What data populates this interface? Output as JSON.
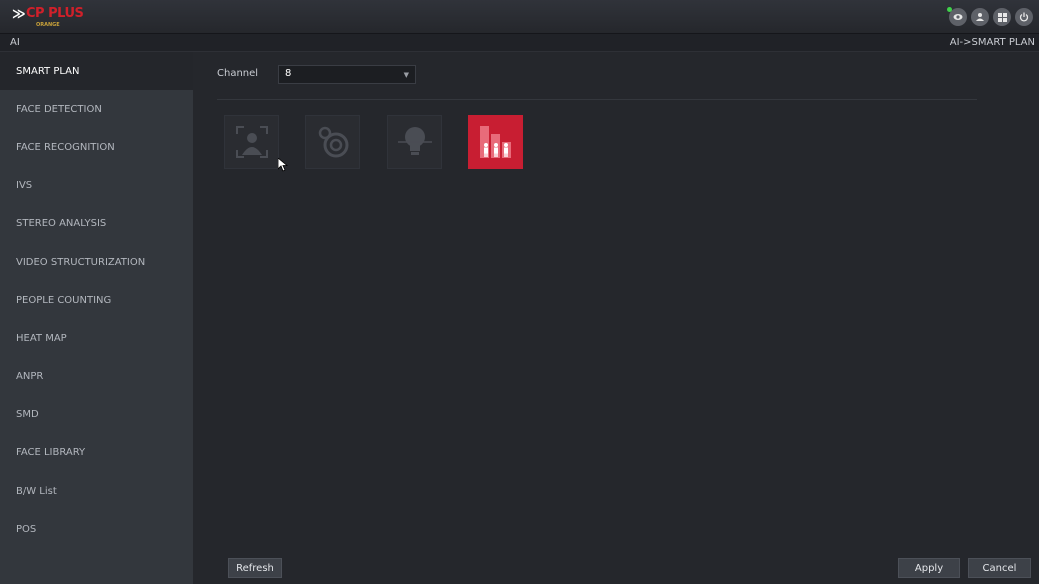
{
  "header": {
    "logo_brand": "CP PLUS",
    "logo_sub": "ORANGE",
    "icons": [
      "monitor-icon",
      "user-icon",
      "grid-icon",
      "power-icon"
    ]
  },
  "breadcrumb": {
    "section": "AI",
    "path": "AI->SMART PLAN"
  },
  "sidebar": {
    "items": [
      {
        "label": "SMART PLAN",
        "active": true
      },
      {
        "label": "FACE DETECTION",
        "active": false
      },
      {
        "label": "FACE RECOGNITION",
        "active": false
      },
      {
        "label": "IVS",
        "active": false
      },
      {
        "label": "STEREO ANALYSIS",
        "active": false
      },
      {
        "label": "VIDEO STRUCTURIZATION",
        "active": false
      },
      {
        "label": "PEOPLE COUNTING",
        "active": false
      },
      {
        "label": "HEAT MAP",
        "active": false
      },
      {
        "label": "ANPR",
        "active": false
      },
      {
        "label": "SMD",
        "active": false
      },
      {
        "label": "FACE LIBRARY",
        "active": false
      },
      {
        "label": "B/W List",
        "active": false
      },
      {
        "label": "POS",
        "active": false
      }
    ]
  },
  "main": {
    "channel_label": "Channel",
    "channel_value": "8",
    "plans": [
      {
        "icon": "face-recognition-icon",
        "active": false
      },
      {
        "icon": "stereo-analysis-icon",
        "active": false
      },
      {
        "icon": "heat-map-icon",
        "active": false
      },
      {
        "icon": "people-counting-icon",
        "active": true
      }
    ],
    "refresh_label": "Refresh",
    "apply_label": "Apply",
    "cancel_label": "Cancel"
  },
  "colors": {
    "accent": "#c81e32",
    "sidebar_bg": "#33373d",
    "active_item_bg": "#24262b",
    "content_bg": "#25272c"
  }
}
